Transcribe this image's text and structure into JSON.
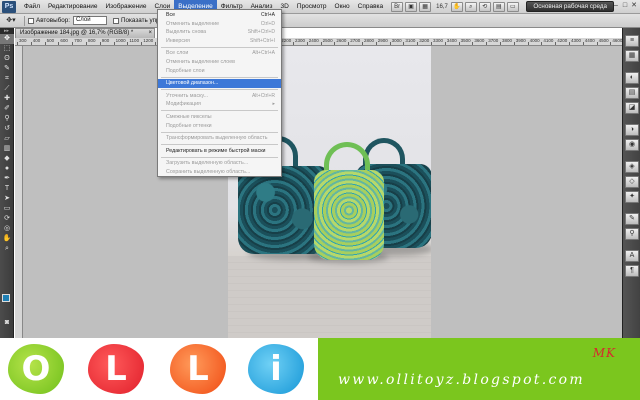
{
  "app": {
    "logo": "Ps"
  },
  "menubar": {
    "items": [
      {
        "label": "Файл"
      },
      {
        "label": "Редактирование"
      },
      {
        "label": "Изображение"
      },
      {
        "label": "Слои"
      },
      {
        "label": "Выделение"
      },
      {
        "label": "Фильтр"
      },
      {
        "label": "Анализ"
      },
      {
        "label": "3D"
      },
      {
        "label": "Просмотр"
      },
      {
        "label": "Окно"
      },
      {
        "label": "Справка"
      }
    ],
    "zoom": "16,7",
    "workspace_label": "Основная рабочая среда",
    "window_buttons": [
      "–",
      "□",
      "✕"
    ]
  },
  "optionsbar": {
    "autoselect_label": "Автовыбор:",
    "layer_select_value": "Слой",
    "show_controls_label": "Показать упр"
  },
  "document": {
    "tab_title": "Изображение 184.jpg @ 16,7% (RGB/8) *",
    "close": "×",
    "ruler_marks": [
      "300",
      "400",
      "500",
      "600",
      "700",
      "800",
      "900",
      "1000",
      "1100",
      "1200",
      "1300",
      "1400",
      "1500",
      "1600",
      "1700",
      "1800",
      "1900",
      "2000",
      "2100",
      "2200",
      "2300",
      "2400",
      "2500",
      "2600",
      "2700",
      "2800",
      "2900",
      "3000",
      "3100",
      "3200",
      "3300",
      "3400",
      "3500",
      "3600",
      "3700",
      "3800",
      "3900",
      "4000",
      "4100",
      "4200",
      "4300",
      "4400",
      "4500",
      "4600"
    ]
  },
  "dropdown": {
    "groups": [
      [
        {
          "label": "Все",
          "shortcut": "Ctrl+A",
          "disabled": false
        },
        {
          "label": "Отменить выделение",
          "shortcut": "Ctrl+D",
          "disabled": true
        },
        {
          "label": "Выделить снова",
          "shortcut": "Shift+Ctrl+D",
          "disabled": true
        },
        {
          "label": "Инверсия",
          "shortcut": "Shift+Ctrl+I",
          "disabled": true
        }
      ],
      [
        {
          "label": "Все слои",
          "shortcut": "Alt+Ctrl+A",
          "disabled": true
        },
        {
          "label": "Отменить выделение слоев",
          "shortcut": "",
          "disabled": true
        },
        {
          "label": "Подобные слои",
          "shortcut": "",
          "disabled": true
        }
      ],
      [
        {
          "label": "Цветовой диапазон...",
          "shortcut": "",
          "disabled": false,
          "highlighted": true
        }
      ],
      [
        {
          "label": "Уточнить маску...",
          "shortcut": "Alt+Ctrl+R",
          "disabled": true
        },
        {
          "label": "Модификация",
          "shortcut": "▸",
          "disabled": true
        }
      ],
      [
        {
          "label": "Смежные пикселы",
          "shortcut": "",
          "disabled": true
        },
        {
          "label": "Подобные оттенки",
          "shortcut": "",
          "disabled": true
        }
      ],
      [
        {
          "label": "Трансформировать выделенную область",
          "shortcut": "",
          "disabled": true
        }
      ],
      [
        {
          "label": "Редактировать в режиме быстрой маски",
          "shortcut": "",
          "disabled": false
        }
      ],
      [
        {
          "label": "Загрузить выделенную область...",
          "shortcut": "",
          "disabled": true
        },
        {
          "label": "Сохранить выделенную область...",
          "shortcut": "",
          "disabled": true
        }
      ]
    ]
  },
  "banner": {
    "letters": [
      "O",
      "L",
      "L",
      "i"
    ],
    "mark": "MK",
    "url": "www.ollitoyz.blogspot.com"
  },
  "colors": {
    "banner_green": "#7bc61e",
    "menu_highlight": "#3d78d8",
    "foreground_swatch": "#1e7fb4"
  }
}
